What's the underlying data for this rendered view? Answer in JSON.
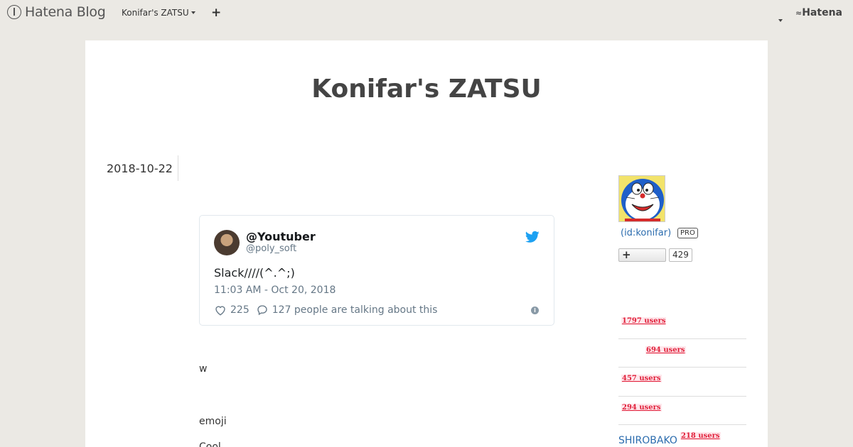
{
  "topbar": {
    "logo_text": "Hatena Blog",
    "blog_menu_label": "Konifar's ZATSU",
    "add_label": "+",
    "hatena_label": "Hatena"
  },
  "blog": {
    "title": "Konifar's ZATSU"
  },
  "entry": {
    "date": "2018-10-22",
    "lines": [
      "w",
      "emoji",
      "Cool"
    ]
  },
  "tweet": {
    "name": "@Youtuber",
    "handle": "@poly_soft",
    "text": "Slack////(^.^;)",
    "timestamp": "11:03 AM - Oct 20, 2018",
    "likes": "225",
    "talking": "127 people are talking about this",
    "info_label": "i",
    "accent": "#1da1f2"
  },
  "sidebar": {
    "user_id": "(id:konifar)",
    "pro_badge": "PRO",
    "subscribe_label": "+",
    "subscriber_count": "429",
    "bookmarks": [
      {
        "title": "",
        "users": "1797 users"
      },
      {
        "title": "",
        "users": "694 users"
      },
      {
        "title": "",
        "users": "457 users"
      },
      {
        "title": "",
        "users": "294 users"
      },
      {
        "title": "SHIROBAKO",
        "users": "218 users"
      }
    ]
  },
  "colors": {
    "background": "#ebe9e4",
    "link": "#2b6cae",
    "users_badge": "#e0203a"
  }
}
